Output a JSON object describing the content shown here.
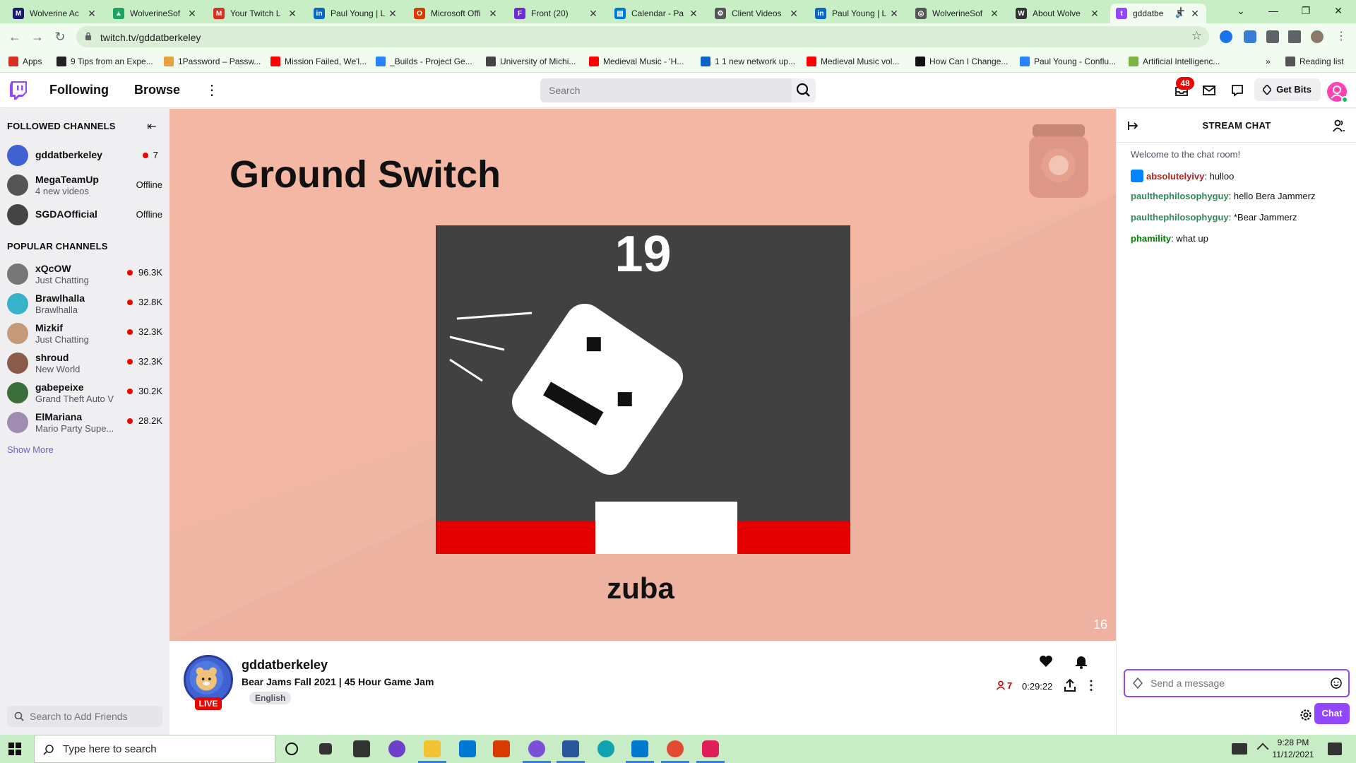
{
  "browser": {
    "tabs": [
      {
        "title": "Wolverine Ac",
        "color": "#1a1a6e",
        "glyph": "M"
      },
      {
        "title": "WolverineSof",
        "color": "#1ea362",
        "glyph": "▲"
      },
      {
        "title": "Your Twitch L",
        "color": "#d93025",
        "glyph": "M"
      },
      {
        "title": "Paul Young | L",
        "color": "#0a66c2",
        "glyph": "in"
      },
      {
        "title": "Microsoft Offi",
        "color": "#d83b01",
        "glyph": "O"
      },
      {
        "title": "Front (20)",
        "color": "#6b2bd9",
        "glyph": "F"
      },
      {
        "title": "Calendar - Pa",
        "color": "#0078d4",
        "glyph": "▤"
      },
      {
        "title": "Client Videos",
        "color": "#555555",
        "glyph": "⚙"
      },
      {
        "title": "Paul Young | L",
        "color": "#0a66c2",
        "glyph": "in"
      },
      {
        "title": "WolverineSof",
        "color": "#555555",
        "glyph": "◎"
      },
      {
        "title": "About Wolve",
        "color": "#333333",
        "glyph": "W"
      },
      {
        "title": "gddatbe",
        "color": "#9147ff",
        "glyph": "t"
      }
    ],
    "url": "twitch.tv/gddatberkeley",
    "bookmarks": [
      {
        "label": "Apps",
        "color": "#d93025"
      },
      {
        "label": "9 Tips from an Expe...",
        "color": "#222222"
      },
      {
        "label": "1Password – Passw...",
        "color": "#e6a23c"
      },
      {
        "label": "Mission Failed, We'l...",
        "color": "#ff0000"
      },
      {
        "label": "_Builds - Project Ge...",
        "color": "#2684ff"
      },
      {
        "label": "University of Michi...",
        "color": "#444444"
      },
      {
        "label": "Medieval Music - 'H...",
        "color": "#ff0000"
      },
      {
        "label": "1 1 new network up...",
        "color": "#0a66c2"
      },
      {
        "label": "Medieval Music vol...",
        "color": "#ff0000"
      },
      {
        "label": "How Can I Change...",
        "color": "#111111"
      },
      {
        "label": "Paul Young - Conflu...",
        "color": "#2684ff"
      },
      {
        "label": "Artificial Intelligenc...",
        "color": "#7cb342"
      }
    ],
    "reading_list": "Reading list"
  },
  "twitch_nav": {
    "following": "Following",
    "browse": "Browse",
    "search_placeholder": "Search",
    "notifications_count": "48",
    "get_bits": "Get Bits"
  },
  "sidebar": {
    "followed_header": "FOLLOWED CHANNELS",
    "followed": [
      {
        "name": "gddatberkeley",
        "sub": "",
        "status": "7",
        "live": true,
        "color": "#3f62d0"
      },
      {
        "name": "MegaTeamUp",
        "sub": "4 new videos",
        "status": "Offline",
        "live": false,
        "color": "#555555"
      },
      {
        "name": "SGDAOfficial",
        "sub": "",
        "status": "Offline",
        "live": false,
        "color": "#444444"
      }
    ],
    "popular_header": "POPULAR CHANNELS",
    "popular": [
      {
        "name": "xQcOW",
        "sub": "Just Chatting",
        "status": "96.3K",
        "color": "#777777"
      },
      {
        "name": "Brawlhalla",
        "sub": "Brawlhalla",
        "status": "32.8K",
        "color": "#38b2c8"
      },
      {
        "name": "Mizkif",
        "sub": "Just Chatting",
        "status": "32.3K",
        "color": "#c49a7a"
      },
      {
        "name": "shroud",
        "sub": "New World",
        "status": "32.3K",
        "color": "#8b5a4a"
      },
      {
        "name": "gabepeixe",
        "sub": "Grand Theft Auto V",
        "status": "30.2K",
        "color": "#3a6e3a"
      },
      {
        "name": "ElMariana",
        "sub": "Mario Party Supe...",
        "status": "28.2K",
        "color": "#a08cb0"
      }
    ],
    "show_more": "Show More",
    "friends_placeholder": "Search to Add Friends"
  },
  "player": {
    "game_title": "Ground Switch",
    "score": "19",
    "player_name": "zuba",
    "corner_number": "16"
  },
  "stream_info": {
    "streamer": "gddatberkeley",
    "title": "Bear Jams Fall 2021 | 45 Hour Game Jam",
    "language": "English",
    "live_label": "LIVE",
    "viewers": "7",
    "uptime": "0:29:22"
  },
  "chat": {
    "header": "STREAM CHAT",
    "welcome": "Welcome to the chat room!",
    "messages": [
      {
        "user": "absolutelyivy",
        "text": ": hulloo",
        "color": "#b22222",
        "badge": true
      },
      {
        "user": "paulthephilosophyguy",
        "text": ": hello Bera Jammerz",
        "color": "#2e8b57",
        "badge": false
      },
      {
        "user": "paulthephilosophyguy",
        "text": ": *Bear Jammerz",
        "color": "#2e8b57",
        "badge": false
      },
      {
        "user": "phamility",
        "text": ": what up",
        "color": "#008000",
        "badge": false
      }
    ],
    "input_placeholder": "Send a message",
    "send_label": "Chat"
  },
  "taskbar": {
    "search_placeholder": "Type here to search",
    "time": "9:28 PM",
    "date": "11/12/2021"
  }
}
